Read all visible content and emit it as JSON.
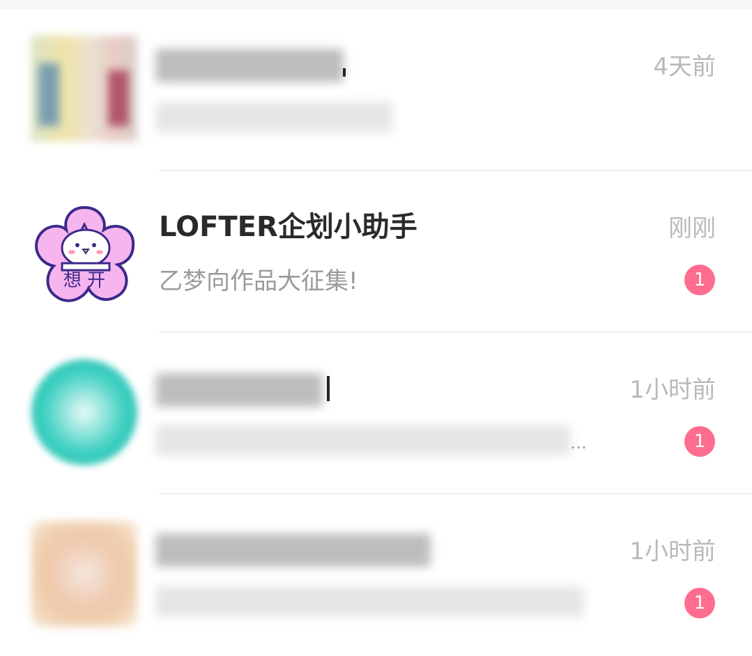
{
  "conversations": [
    {
      "time": "4天前"
    },
    {
      "title": "LOFTER企划小助手",
      "subtitle": "乙梦向作品大征集!",
      "time": "刚刚",
      "badge": "1",
      "avatar_text": "想 开"
    },
    {
      "time": "1小时前",
      "badge": "1",
      "preview_ellipsis": "…"
    },
    {
      "time": "1小时前",
      "badge": "1"
    }
  ],
  "colors": {
    "badge": "#ff6d8e",
    "time": "#b9b9b9",
    "title": "#2a2a2a",
    "avatar_pink": "#f7b5ef",
    "avatar_teal": "#3ccfc0"
  },
  "icons": {
    "avatar2": "duck-mascot-flower-icon"
  }
}
